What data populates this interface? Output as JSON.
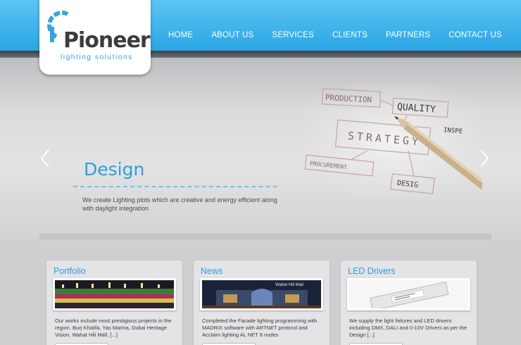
{
  "brand": {
    "name": "Pioneer",
    "tagline": "lighting solutions",
    "accent_color": "#2c9fd9",
    "icon": "pioneer-logo-mark"
  },
  "nav": {
    "items": [
      {
        "label": "HOME"
      },
      {
        "label": "ABOUT US"
      },
      {
        "label": "SERVICES"
      },
      {
        "label": "CLIENTS"
      },
      {
        "label": "PARTNERS"
      },
      {
        "label": "CONTACT US"
      }
    ]
  },
  "slider": {
    "title": "Design",
    "description": "We create Lighting plots which are creative and energy efficient along with daylight integration",
    "prev_icon": "chevron-left-icon",
    "next_icon": "chevron-right-icon",
    "image": {
      "icon": "strategy-sketch-image",
      "words": [
        "PRODUCTION",
        "QUALITY",
        "STRATEGY",
        "PROCUREMENT",
        "INSPE",
        "DESIG"
      ]
    }
  },
  "cards": [
    {
      "title": "Portfolio",
      "image": "lit-building-night-photo",
      "text": "Our works include most prestigious projects in the region. Burj Khalifa, Yas Marina, Dubai Heritage Vision, Wahat Hili Mall, [...]"
    },
    {
      "title": "News",
      "image": "wahat-hili-mall-night-photo",
      "image_caption": "Wahat Hili Mall",
      "text": "Completed the Facade lighting programming with MADRIX software with ARTNET protocol and Acclaim lighting AL NET 8 nodes"
    },
    {
      "title": "LED Drivers",
      "image": "led-driver-product-photo",
      "text": "We supply the light fixtures and LED drivers including DMX, DALI and 0-10V Drivers as per the Design [...]"
    }
  ]
}
